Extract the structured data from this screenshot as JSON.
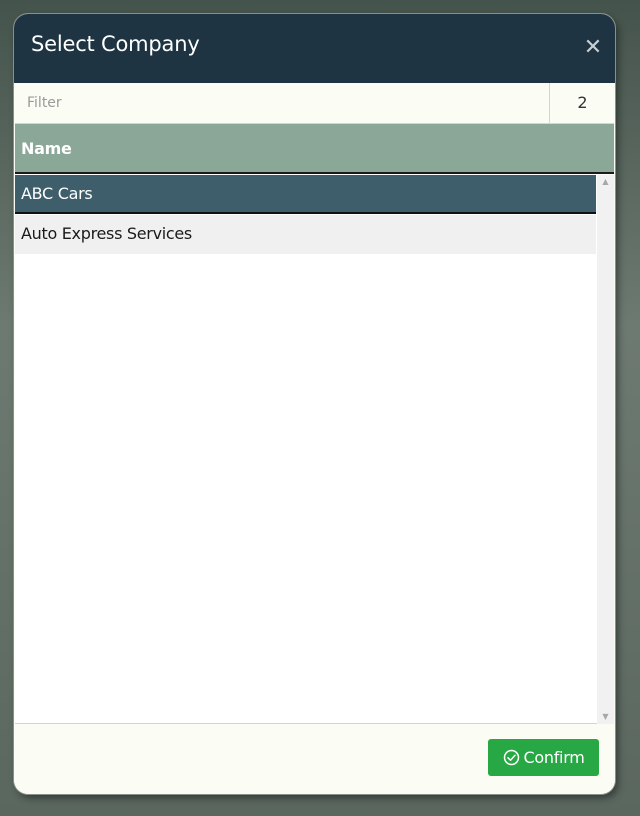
{
  "dialog": {
    "title": "Select Company",
    "close_icon": "close-icon",
    "close_glyph": "✕"
  },
  "filter": {
    "placeholder": "Filter",
    "value": "",
    "count": "2"
  },
  "table": {
    "columns": [
      "Name"
    ],
    "rows": [
      {
        "name": "ABC Cars",
        "selected": true
      },
      {
        "name": "Auto Express Services",
        "selected": false
      }
    ]
  },
  "scrollbar": {
    "up_glyph": "▲",
    "down_glyph": "▼"
  },
  "footer": {
    "confirm_label": "Confirm",
    "confirm_icon": "check-circle-icon"
  },
  "colors": {
    "header_bg": "#1e3442",
    "table_header_bg": "#8ba798",
    "selected_row_bg": "#3e5e6c",
    "confirm_bg": "#28a745"
  }
}
